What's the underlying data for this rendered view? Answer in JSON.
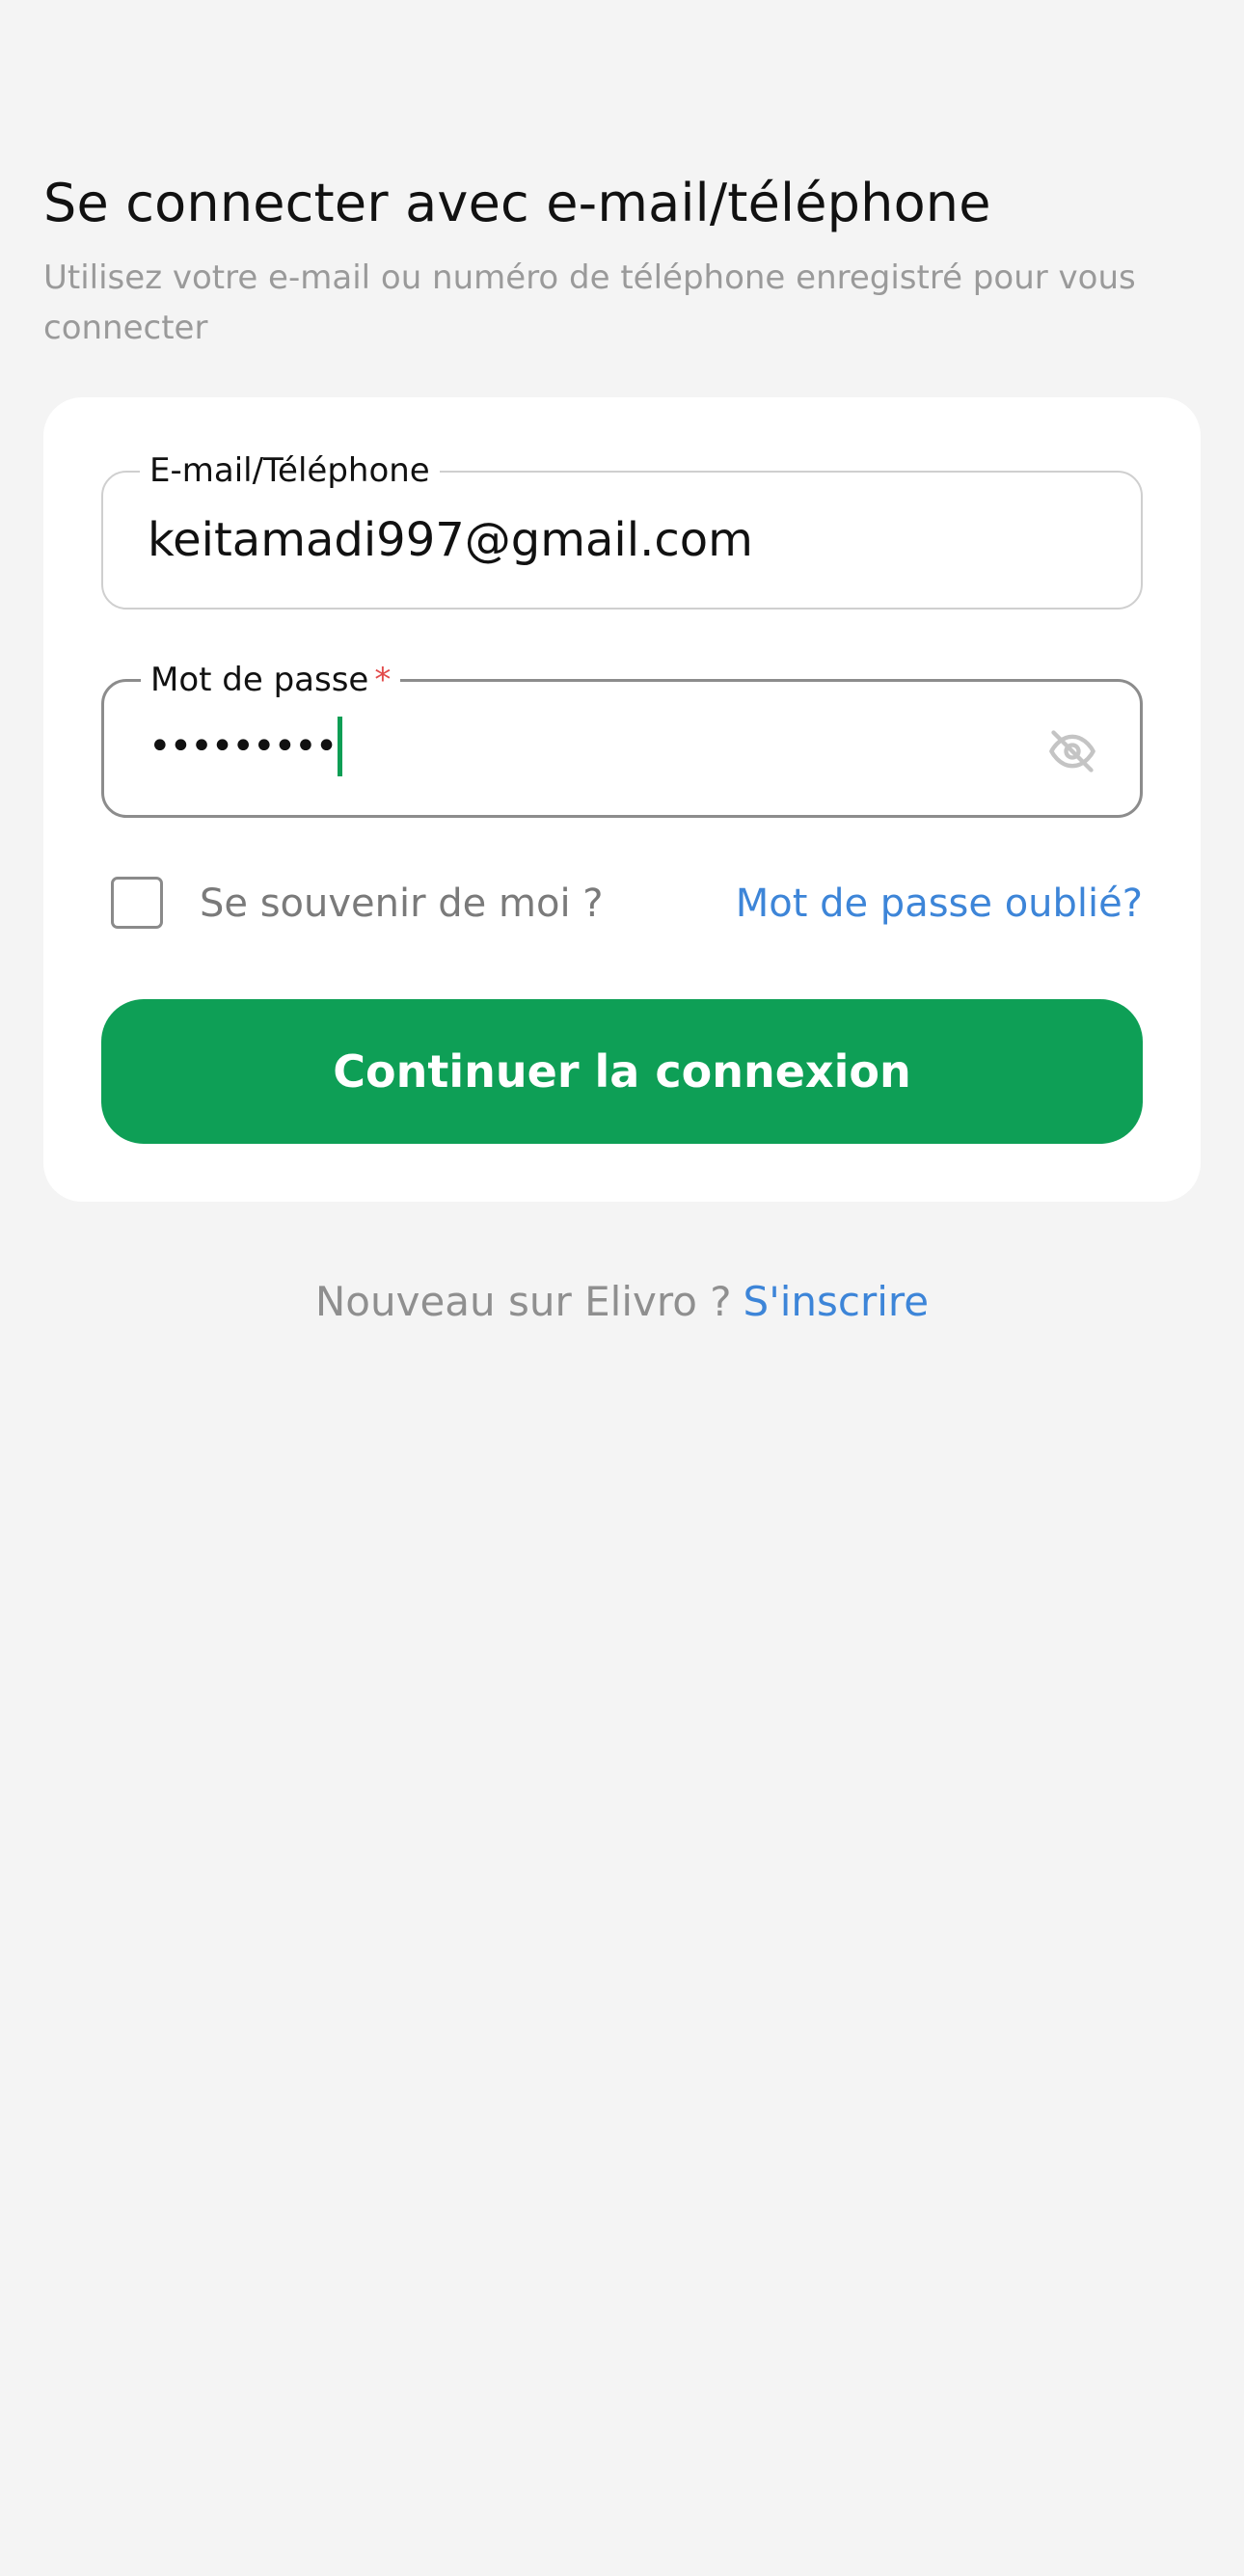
{
  "header": {
    "title": "Se connecter avec e-mail/téléphone",
    "subtitle": "Utilisez votre e-mail ou numéro de téléphone enregistré pour vous connecter"
  },
  "form": {
    "email_label": "E-mail/Téléphone",
    "email_value": "keitamadi997@gmail.com",
    "password_label": "Mot de passe",
    "password_required_mark": "*",
    "password_masked": "•••••••••",
    "password_visibility_icon": "eye-off-icon",
    "remember_me_label": "Se souvenir de moi ?",
    "remember_me_checked": false,
    "forgot_password_label": "Mot de passe oublié?",
    "submit_label": "Continuer la connexion"
  },
  "signup": {
    "prompt": "Nouveau sur Elivro ?",
    "link_label": "S'inscrire"
  },
  "colors": {
    "background": "#f4f4f4",
    "card": "#ffffff",
    "primary_green": "#0e9f56",
    "link_blue": "#3d85d8",
    "required_red": "#e24b4b"
  }
}
